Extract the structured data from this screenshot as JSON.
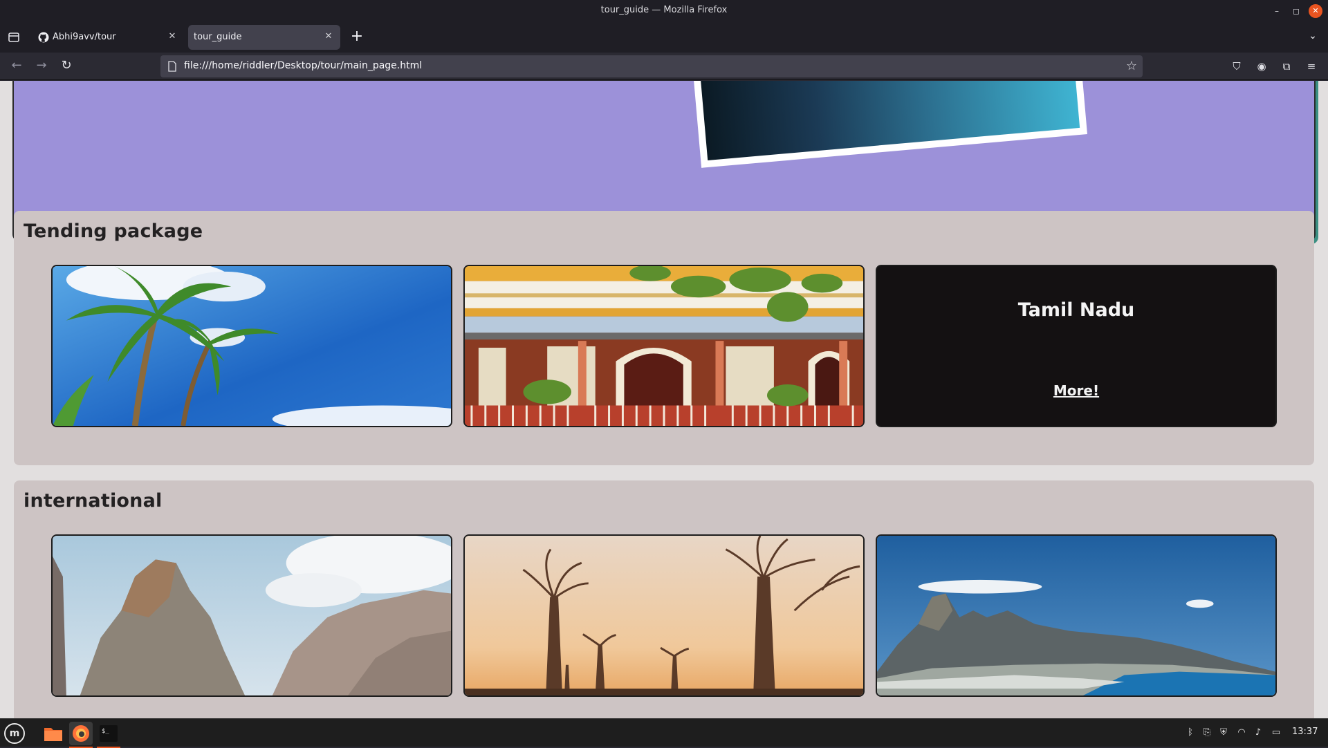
{
  "window": {
    "title": "tour_guide — Mozilla Firefox",
    "controls": {
      "minimize": "–",
      "maximize": "◻",
      "close": "✕"
    }
  },
  "tabs": [
    {
      "label": "Abhi9avv/tour",
      "icon": "github-icon",
      "active": false
    },
    {
      "label": "tour_guide",
      "icon": "",
      "active": true
    }
  ],
  "navbar": {
    "url": "file:///home/riddler/Desktop/tour/main_page.html"
  },
  "page": {
    "sections": [
      {
        "title": "Tending package",
        "cards": [
          {
            "image": "palm-trees-blue-sky"
          },
          {
            "image": "colonial-balcony-building"
          },
          {
            "title": "Tamil Nadu",
            "link": "More!"
          }
        ]
      },
      {
        "title": "international",
        "cards": [
          {
            "image": "limestone-cliffs"
          },
          {
            "image": "baobab-trees-sunset"
          },
          {
            "image": "mountain-coastline"
          }
        ]
      }
    ]
  },
  "taskbar": {
    "menu_label": "m",
    "clock": "13:37"
  },
  "colors": {
    "hero_bg": "#9c91d9",
    "section_bg": "#cdc4c4",
    "page_bg": "#e2dfdf",
    "accent": "#e95420"
  }
}
